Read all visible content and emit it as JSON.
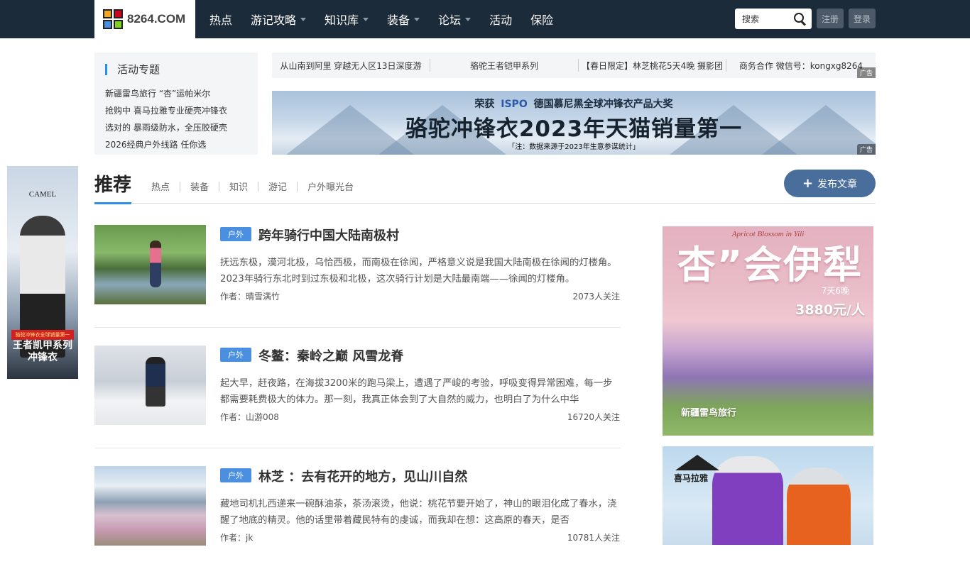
{
  "header": {
    "logo_text": "8264.COM",
    "nav": [
      {
        "label": "热点",
        "dropdown": false
      },
      {
        "label": "游记攻略",
        "dropdown": true
      },
      {
        "label": "知识库",
        "dropdown": true
      },
      {
        "label": "装备",
        "dropdown": true
      },
      {
        "label": "论坛",
        "dropdown": true
      },
      {
        "label": "活动",
        "dropdown": false
      },
      {
        "label": "保险",
        "dropdown": false
      }
    ],
    "search_placeholder": "搜索",
    "register_label": "注册",
    "login_label": "登录"
  },
  "side_ad": {
    "brand": "CAMEL",
    "strip": "骆驼冲锋衣全球销量第一",
    "line1": "王者凯甲系列",
    "line2": "冲锋衣"
  },
  "activity": {
    "title": "活动专题",
    "items": [
      "新疆雷鸟旅行 “杏”运帕米尔",
      "抢购中 喜马拉雅专业硬壳冲锋衣",
      "选对的 暴雨级防水，全压胶硬壳",
      "2026经典户外线路 任你选"
    ]
  },
  "ticker": {
    "items": [
      "从山南到阿里 穿越无人区13日深度游",
      "骆驼王者铠甲系列",
      "【春日限定】林芝桃花5天4晚 摄影团",
      "商务合作 微信号：kongxg8264"
    ],
    "ad_label": "广告"
  },
  "banner": {
    "line1_pre": "荣获",
    "line1_logo": "ISPO",
    "line1_post": "德国慕尼黑全球冲锋衣产品大奖",
    "line2": "骆驼冲锋衣2023年天猫销量第一",
    "line3": "「注：数据来源于2023年生意参谋统计」",
    "ad_label": "广告"
  },
  "recommend": {
    "title": "推荐",
    "tabs": [
      "热点",
      "装备",
      "知识",
      "游记",
      "户外曝光台"
    ],
    "publish_label": "发布文章"
  },
  "articles": [
    {
      "tag": "户外",
      "title": "跨年骑行中国大陆南极村",
      "summary": "抚远东极，漠河北极，乌恰西极，而南极在徐闻，严格意义说是我国大陆南极在徐闻的灯楼角。2023年骑行东北时到过东极和北极，这次骑行计划是大陆最南端——徐闻的灯楼角。",
      "author": "作者：晴雪满竹",
      "followers": "2073人关注"
    },
    {
      "tag": "户外",
      "title": "冬鳌：秦岭之巅 风雪龙脊",
      "summary": "起大早，赶夜路，在海拔3200米的跑马梁上，遭遇了严峻的考验，呼吸变得异常困难，每一步都需要耗费极大的体力。那一刻，我真正体会到了大自然的威力，也明白了为什么中华",
      "author": "作者：山游008",
      "followers": "16720人关注"
    },
    {
      "tag": "户外",
      "title": "林芝 ：去有花开的地方，见山川自然",
      "summary": "藏地司机扎西递来一碗酥油茶，茶汤滚烫，他说：桃花节要开始了，神山的眼泪化成了春水，浇醒了地底的精灵。他的话里带着藏民特有的虔诚，而我却在想：这高原的春天，是否",
      "author": "作者：jk",
      "followers": "10781人关注"
    }
  ],
  "right_ad1": {
    "sub": "Apricot Blossom in Yili",
    "big": "杏”会伊犁",
    "days": "7天6晚",
    "price": "3880元/人",
    "brand": "新疆雷鸟旅行"
  },
  "right_ad2": {
    "brand": "喜马拉雅"
  },
  "colors": {
    "topbar": "#1c2b3a",
    "accent": "#2b8fe6",
    "tag": "#4a8fe0",
    "publish": "#4a6e9b"
  }
}
